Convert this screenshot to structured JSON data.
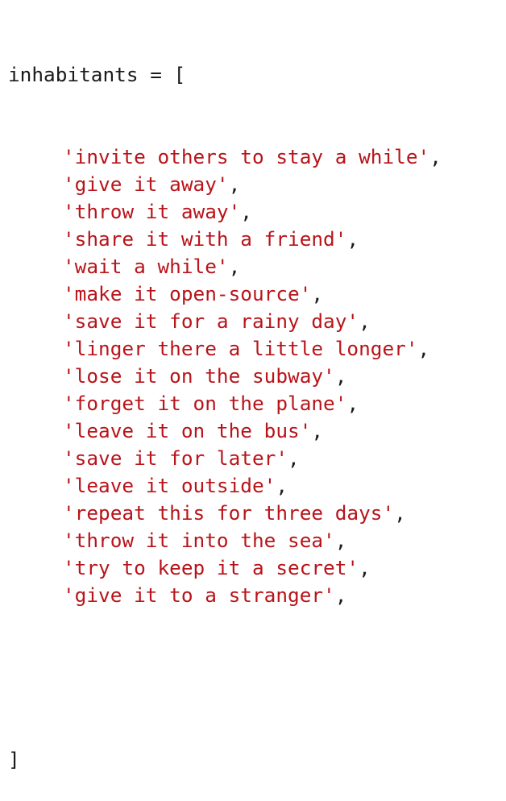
{
  "code": {
    "declaration": "inhabitants = [",
    "items": [
      "'invite others to stay a while'",
      "'give it away'",
      "'throw it away'",
      "'share it with a friend'",
      "'wait a while'",
      "'make it open-source'",
      "'save it for a rainy day'",
      "'linger there a little longer'",
      "'lose it on the subway'",
      "'forget it on the plane'",
      "'leave it on the bus'",
      "'save it for later'",
      "'leave it outside'",
      "'repeat this for three days'",
      "'throw it into the sea'",
      "'try to keep it a secret'",
      "'give it to a stranger'"
    ],
    "separator": ",",
    "closing": "]"
  },
  "colors": {
    "string": "#b8141a",
    "text": "#1a1a1a",
    "background": "#ffffff"
  }
}
